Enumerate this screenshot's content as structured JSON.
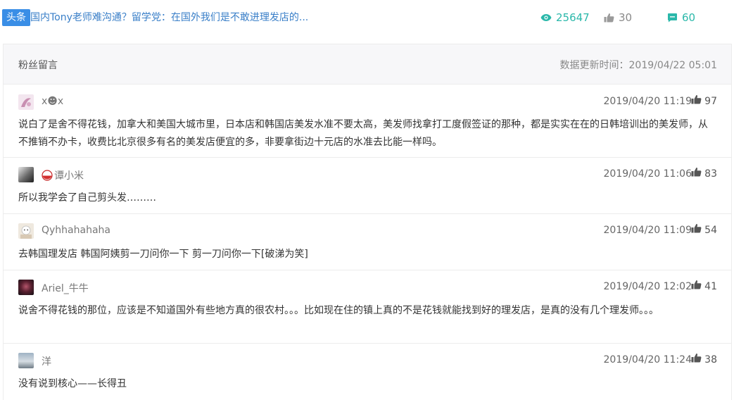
{
  "article": {
    "tag": "头条",
    "title": "国内Tony老师难沟通？留学党：在国外我们是不敢进理发店的...",
    "views": "25647",
    "likes": "30",
    "comments": "60"
  },
  "panel": {
    "title": "粉丝留言",
    "updated": "数据更新时间：2019/04/22 05:01"
  },
  "comments": [
    {
      "name": "x☻x",
      "time": "2019/04/20 11:19",
      "likes": "97",
      "text": "说白了是舍不得花钱，加拿大和美国大城市里，日本店和韩国店美发水准不要太高，美发师找拿打工度假签证的那种，都是实实在在的日韩培训出的美发师，从不推销不办卡，收费比北京很多有名的美发店便宜的多，非要拿街边十元店的水准去比能一样吗。"
    },
    {
      "name": "谭小米",
      "time": "2019/04/20 11:06",
      "likes": "83",
      "text": "所以我学会了自己剪头发………"
    },
    {
      "name": "Qyhhahahaha",
      "time": "2019/04/20 11:09",
      "likes": "54",
      "text": "去韩国理发店 韩国阿姨剪一刀问你一下 剪一刀问你一下[破涕为笑]"
    },
    {
      "name": "Ariel_牛牛",
      "time": "2019/04/20 12:02",
      "likes": "41",
      "text": "说舍不得花钱的那位，应该是不知道国外有些地方真的很农村。。。比如现在住的镇上真的不是花钱就能找到好的理发店，是真的没有几个理发师。。。"
    },
    {
      "name": "洋",
      "time": "2019/04/20 11:24",
      "likes": "38",
      "text": "没有说到核心——长得丑"
    }
  ],
  "colors": {
    "accent": "#3a8ee6",
    "teal": "#2bb8aa",
    "link": "#3a7fc8"
  },
  "icons": [
    "eye-icon",
    "thumbs-up-icon",
    "comment-icon"
  ]
}
